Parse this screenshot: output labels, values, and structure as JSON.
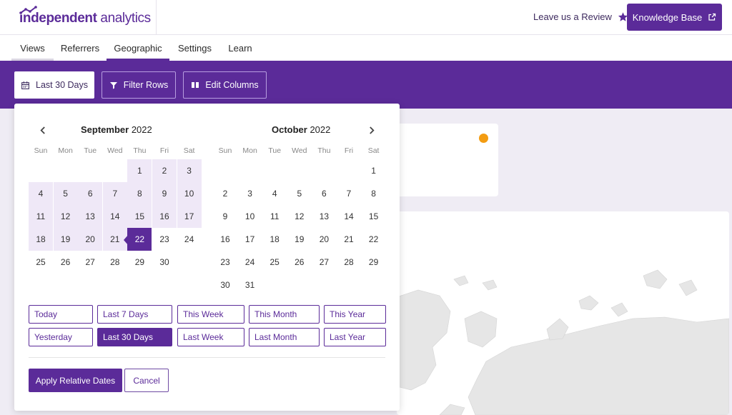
{
  "header": {
    "logo_bold": "independent",
    "logo_light": " analytics",
    "review_label": "Leave us a Review",
    "kb_label": "Knowledge Base"
  },
  "tabs": [
    {
      "label": "Views"
    },
    {
      "label": "Referrers"
    },
    {
      "label": "Geographic"
    },
    {
      "label": "Settings"
    },
    {
      "label": "Learn"
    }
  ],
  "toolbar": {
    "date_label": "Last 30 Days",
    "filter_label": "Filter Rows",
    "columns_label": "Edit Columns"
  },
  "picker": {
    "left_month": "September",
    "left_year": " 2022",
    "right_month": "October",
    "right_year": " 2022",
    "weekdays": [
      "Sun",
      "Mon",
      "Tue",
      "Wed",
      "Thu",
      "Fri",
      "Sat"
    ],
    "left_first_weekday": 4,
    "left_days_in_month": 30,
    "right_first_weekday": 6,
    "right_days_in_month": 31,
    "range_start_day": 1,
    "range_end_day": 22,
    "range_labels": [
      [
        "Today",
        "Last 7 Days",
        "This Week",
        "This Month",
        "This Year"
      ],
      [
        "Yesterday",
        "Last 30 Days",
        "Last Week",
        "Last Month",
        "Last Year"
      ]
    ],
    "active_range": "Last 30 Days",
    "apply_label": "Apply Relative Dates",
    "cancel_label": "Cancel"
  },
  "colors": {
    "brand": "#5b2b99",
    "range_bg": "#efe8f7",
    "indicator": "#f39c12"
  }
}
